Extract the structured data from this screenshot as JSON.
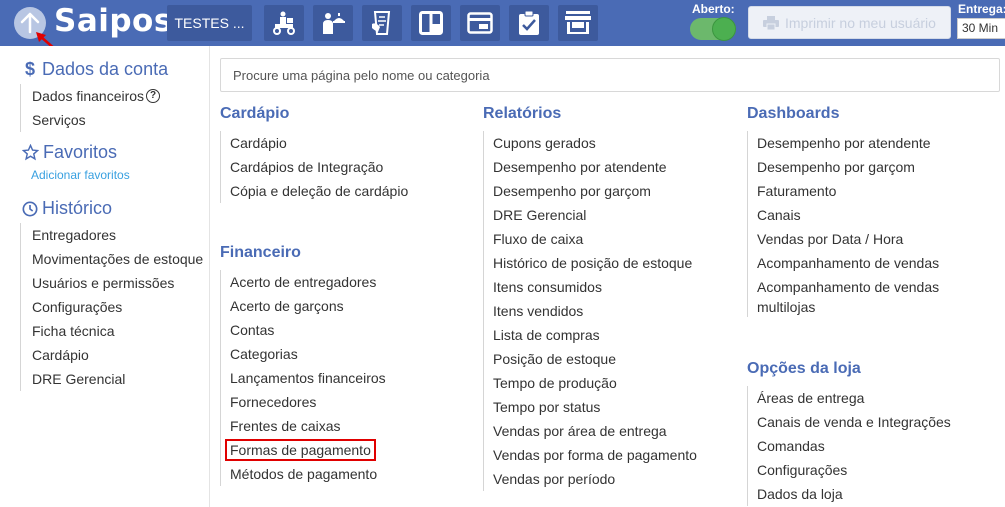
{
  "topbar": {
    "logo": "Saipos",
    "store_name": "TESTES ...",
    "tools": [
      {
        "icon": "delivery-scooter-icon"
      },
      {
        "icon": "waiter-icon"
      },
      {
        "icon": "order-ticket-icon"
      },
      {
        "icon": "kanban-board-icon"
      },
      {
        "icon": "card-reader-icon"
      },
      {
        "icon": "clipboard-check-icon"
      },
      {
        "icon": "storefront-icon"
      }
    ],
    "status_label": "Aberto:",
    "print_label": "Imprimir no meu usuário",
    "delivery_label": "Entrega:",
    "delivery_value": "30 Min"
  },
  "sidebar": {
    "account": {
      "title": "Dados da conta",
      "items": [
        "Dados financeiros",
        "Serviços"
      ]
    },
    "favorites": {
      "title": "Favoritos",
      "add_link": "Adicionar favoritos"
    },
    "history": {
      "title": "Histórico",
      "items": [
        "Entregadores",
        "Movimentações de estoque",
        "Usuários e permissões",
        "Configurações",
        "Ficha técnica",
        "Cardápio",
        "DRE Gerencial"
      ]
    }
  },
  "search": {
    "placeholder": "Procure uma página pelo nome ou categoria"
  },
  "categories": {
    "cardapio": {
      "title": "Cardápio",
      "items": [
        "Cardápio",
        "Cardápios de Integração",
        "Cópia e deleção de cardápio"
      ]
    },
    "financeiro": {
      "title": "Financeiro",
      "items": [
        "Acerto de entregadores",
        "Acerto de garçons",
        "Contas",
        "Categorias",
        "Lançamentos financeiros",
        "Fornecedores",
        "Frentes de caixas",
        "Formas de pagamento",
        "Métodos de pagamento"
      ]
    },
    "relatorios": {
      "title": "Relatórios",
      "items": [
        "Cupons gerados",
        "Desempenho por atendente",
        "Desempenho por garçom",
        "DRE Gerencial",
        "Fluxo de caixa",
        "Histórico de posição de estoque",
        "Itens consumidos",
        "Itens vendidos",
        "Lista de compras",
        "Posição de estoque",
        "Tempo de produção",
        "Tempo por status",
        "Vendas por área de entrega",
        "Vendas por forma de pagamento",
        "Vendas por período"
      ]
    },
    "dashboards": {
      "title": "Dashboards",
      "items": [
        "Desempenho por atendente",
        "Desempenho por garçom",
        "Faturamento",
        "Canais",
        "Vendas por Data / Hora",
        "Acompanhamento de vendas",
        "Acompanhamento de vendas multilojas"
      ]
    },
    "opcoes": {
      "title": "Opções da loja",
      "items": [
        "Áreas de entrega",
        "Canais de venda e Integrações",
        "Comandas",
        "Configurações",
        "Dados da loja"
      ]
    }
  }
}
